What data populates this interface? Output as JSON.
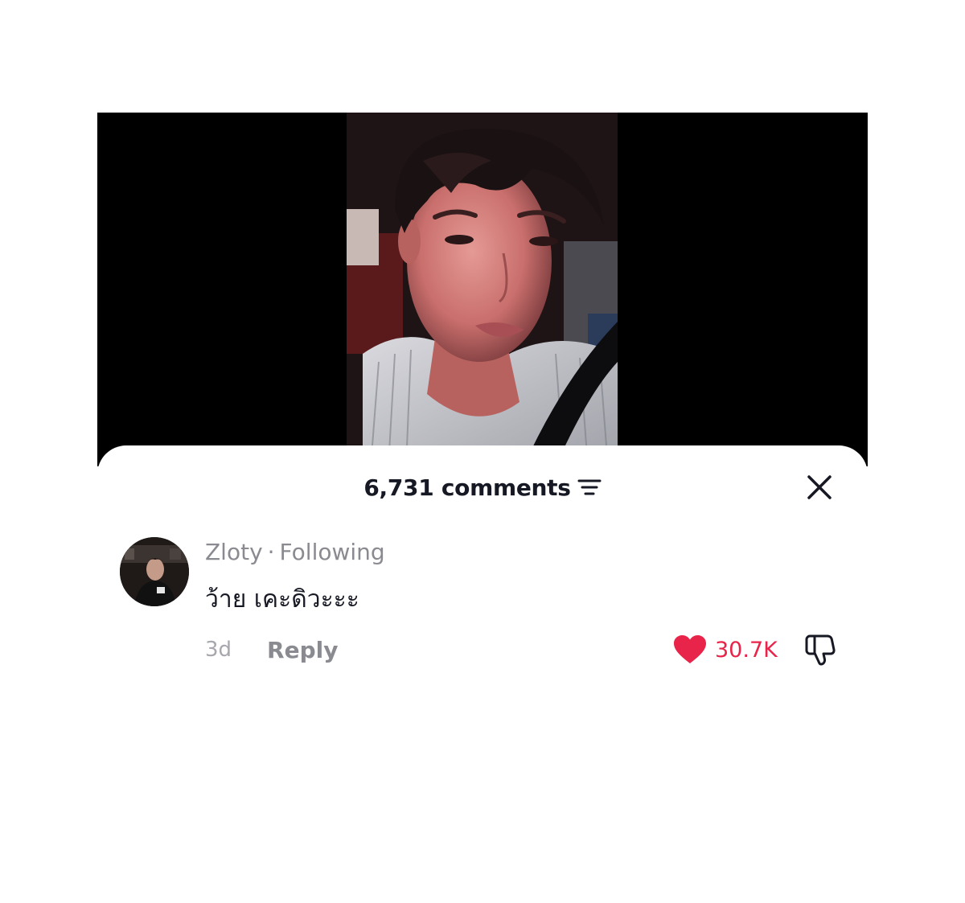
{
  "comments_sheet": {
    "count_label": "6,731 comments",
    "filter_icon": "filter-lines-icon",
    "close_icon": "close-x-icon"
  },
  "comment": {
    "username": "Zloty",
    "separator": "·",
    "relation": "Following",
    "text": "ว้าย เคะดิวะะะ",
    "time": "3d",
    "reply_label": "Reply",
    "like_count": "30.7K",
    "like_icon": "heart-icon",
    "dislike_icon": "thumbs-down-icon"
  },
  "colors": {
    "like_active": "#e8244a",
    "primary_text": "#161823",
    "secondary_text": "#8a8b91",
    "video_background": "#000000"
  }
}
